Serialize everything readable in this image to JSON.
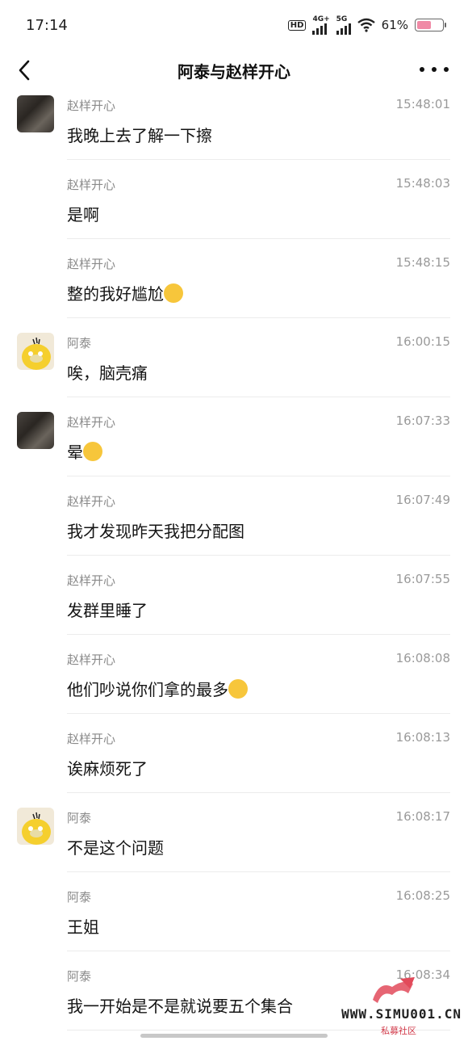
{
  "status": {
    "time": "17:14",
    "hd_label": "HD",
    "net1": "4G+",
    "net2": "5G",
    "battery_text": "61%",
    "battery_level": 0.61
  },
  "header": {
    "title": "阿泰与赵样开心"
  },
  "messages": [
    {
      "sender": "赵样开心",
      "time": "15:48:01",
      "text": "我晚上去了解一下擦",
      "avatar": "zhao"
    },
    {
      "sender": "赵样开心",
      "time": "15:48:03",
      "text": "是啊"
    },
    {
      "sender": "赵样开心",
      "time": "15:48:15",
      "text": "整的我好尴尬",
      "emoji": "sweat-smile-emoji"
    },
    {
      "sender": "阿泰",
      "time": "16:00:15",
      "text": "唉，脑壳痛",
      "avatar": "tai"
    },
    {
      "sender": "赵样开心",
      "time": "16:07:33",
      "text": "晕",
      "emoji": "dizzy-face-emoji",
      "avatar": "zhao"
    },
    {
      "sender": "赵样开心",
      "time": "16:07:49",
      "text": "我才发现昨天我把分配图"
    },
    {
      "sender": "赵样开心",
      "time": "16:07:55",
      "text": "发群里睡了"
    },
    {
      "sender": "赵样开心",
      "time": "16:08:08",
      "text": "他们吵说你们拿的最多",
      "emoji": "crying-laughing-emoji"
    },
    {
      "sender": "赵样开心",
      "time": "16:08:13",
      "text": "诶麻烦死了"
    },
    {
      "sender": "阿泰",
      "time": "16:08:17",
      "text": "不是这个问题",
      "avatar": "tai"
    },
    {
      "sender": "阿泰",
      "time": "16:08:25",
      "text": "王姐"
    },
    {
      "sender": "阿泰",
      "time": "16:08:34",
      "text": "我一开始是不是就说要五个集合"
    }
  ],
  "watermark": {
    "site": "WWW.SIMU001.CN",
    "sub": "私募社区"
  },
  "colors": {
    "battery": "#f08aa6",
    "watermark_red": "#d23a4a",
    "emoji": "#f7c63b"
  }
}
